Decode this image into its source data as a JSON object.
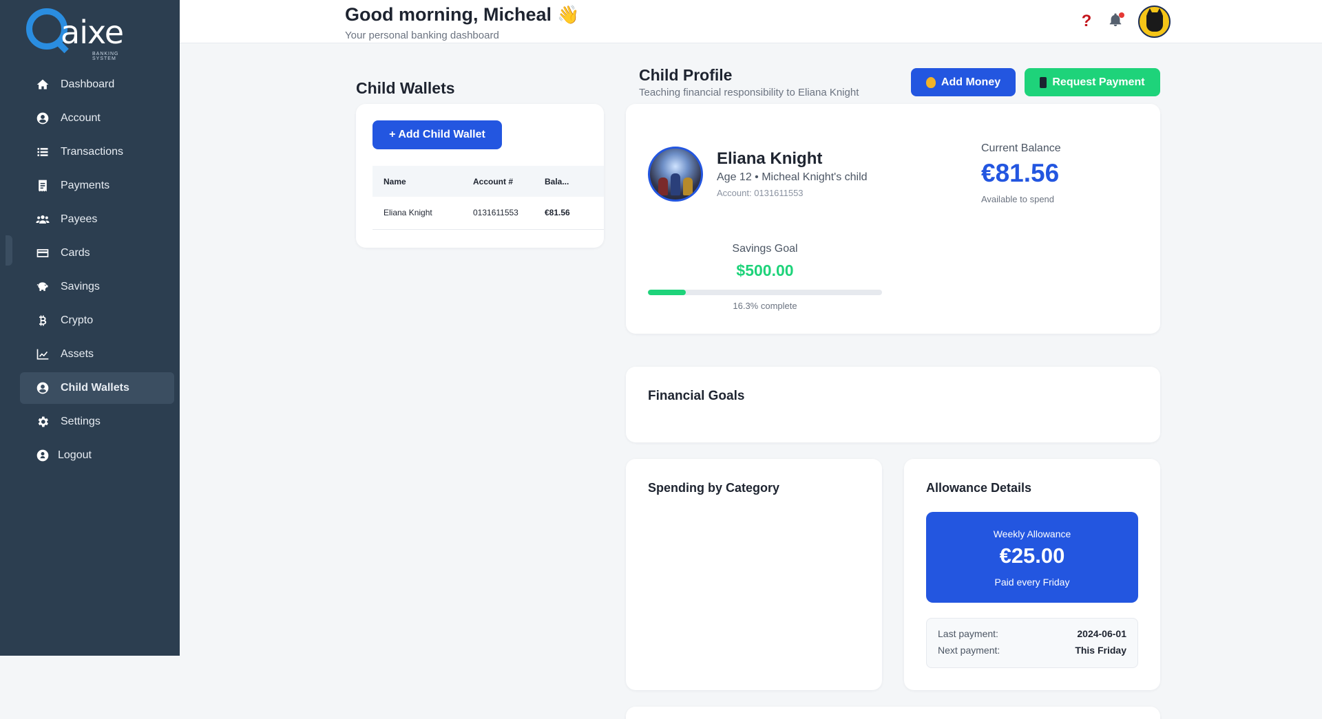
{
  "app": {
    "brand": "aixe",
    "brand_tagline": "BANKING SYSTEM"
  },
  "sidebar": {
    "items": [
      {
        "label": "Dashboard",
        "icon": "home-icon"
      },
      {
        "label": "Account",
        "icon": "user-circle-icon"
      },
      {
        "label": "Transactions",
        "icon": "list-icon"
      },
      {
        "label": "Payments",
        "icon": "receipt-icon"
      },
      {
        "label": "Payees",
        "icon": "users-icon"
      },
      {
        "label": "Cards",
        "icon": "credit-card-icon"
      },
      {
        "label": "Savings",
        "icon": "piggy-bank-icon"
      },
      {
        "label": "Crypto",
        "icon": "bitcoin-icon"
      },
      {
        "label": "Assets",
        "icon": "chart-line-icon"
      },
      {
        "label": "Child Wallets",
        "icon": "user-circle-icon",
        "active": true
      },
      {
        "label": "Settings",
        "icon": "gear-icon"
      },
      {
        "label": "Logout",
        "icon": "logout-icon"
      }
    ]
  },
  "header": {
    "greeting": "Good morning, Micheal",
    "greeting_emoji": "👋",
    "subtitle": "Your personal banking dashboard",
    "help_icon": "question-icon",
    "bell_icon": "bell-icon",
    "has_notification": true
  },
  "wallets": {
    "title": "Child Wallets",
    "add_button": "+ Add Child Wallet",
    "columns": [
      "Name",
      "Account #",
      "Bala..."
    ],
    "rows": [
      {
        "name": "Eliana Knight",
        "account": "0131611553",
        "balance": "€81.56"
      }
    ]
  },
  "profile": {
    "title": "Child Profile",
    "subtitle": "Teaching financial responsibility to Eliana Knight",
    "add_money": "Add Money",
    "request_payment": "Request Payment",
    "name": "Eliana Knight",
    "info": "Age 12 • Micheal Knight's child",
    "account": "Account: 0131611553",
    "balance_label": "Current Balance",
    "balance": "€81.56",
    "balance_note": "Available to spend",
    "goal_label": "Savings Goal",
    "goal_value": "$500.00",
    "goal_progress": 0.163,
    "goal_pct_text": "16.3% complete"
  },
  "financial_goals": {
    "title": "Financial Goals"
  },
  "spending": {
    "title": "Spending by Category"
  },
  "allowance": {
    "title": "Allowance Details",
    "weekly_label": "Weekly Allowance",
    "amount": "€25.00",
    "schedule": "Paid every Friday",
    "last_label": "Last payment:",
    "last_value": "2024-06-01",
    "next_label": "Next payment:",
    "next_value": "This Friday"
  },
  "colors": {
    "sidebar": "#2c3e50",
    "primary": "#2356e0",
    "success": "#1ed37a"
  }
}
